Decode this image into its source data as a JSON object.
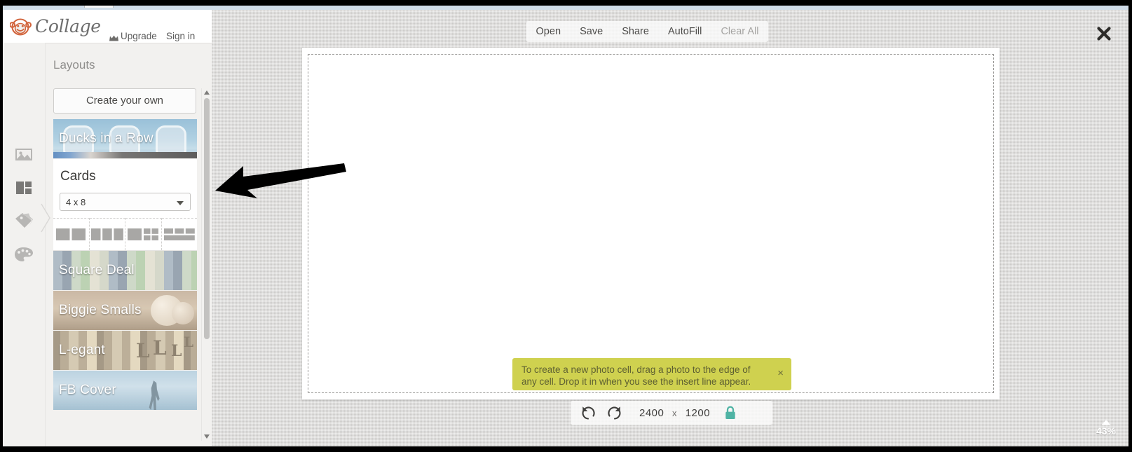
{
  "app": {
    "brand": "Collage",
    "logo_icon": "monkey-face-icon"
  },
  "topbar": {
    "upgrade_label": "Upgrade",
    "upgrade_icon": "crown-icon",
    "signin_label": "Sign in"
  },
  "panel": {
    "title": "Layouts",
    "create_own_label": "Create your own"
  },
  "rail": {
    "items": [
      {
        "name": "photos",
        "icon": "image-icon",
        "active": false
      },
      {
        "name": "layouts",
        "icon": "layouts-grid-icon",
        "active": true
      },
      {
        "name": "swatches",
        "icon": "tags-icon",
        "active": false
      },
      {
        "name": "effects",
        "icon": "palette-icon",
        "active": false
      }
    ],
    "collapse_icon": "chevron-right-icon"
  },
  "layouts": {
    "items": [
      {
        "label": "Ducks in a Row",
        "selected": true
      },
      {
        "label": "Cards",
        "expanded": true
      },
      {
        "label": "Square Deal",
        "selected": false
      },
      {
        "label": "Biggie Smalls",
        "selected": false
      },
      {
        "label": "L-egant",
        "selected": false
      },
      {
        "label": "FB Cover",
        "selected": false
      }
    ],
    "cards": {
      "title": "Cards",
      "size_value": "4 x 8",
      "size_caret_icon": "chevron-down-icon",
      "pattern_count": 4,
      "patterns": [
        "two-column",
        "three-column",
        "one-plus-four",
        "three-top-one-bottom"
      ]
    }
  },
  "scrollbar": {
    "up_icon": "caret-up-icon",
    "down_icon": "caret-down-icon"
  },
  "toolbar": {
    "items": [
      {
        "label": "Open",
        "disabled": false
      },
      {
        "label": "Save",
        "disabled": false
      },
      {
        "label": "Share",
        "disabled": false
      },
      {
        "label": "AutoFill",
        "disabled": false
      },
      {
        "label": "Clear All",
        "disabled": true
      }
    ]
  },
  "workspace": {
    "close_icon": "close-x-icon"
  },
  "toast": {
    "message": "To create a new photo cell, drag a photo to the edge of any cell. Drop it in when you see the insert line appear.",
    "close_label": "×",
    "background_color": "#cfd14f",
    "text_color": "#5e6032"
  },
  "bottombar": {
    "undo_icon": "undo-icon",
    "redo_icon": "redo-icon",
    "width": "2400",
    "separator": "x",
    "height": "1200",
    "lock_icon": "lock-closed-icon",
    "lock_color": "#4fb3a4"
  },
  "zoom": {
    "caret_icon": "caret-up-icon",
    "level": "43%"
  },
  "annotation": {
    "arrow_icon": "left-arrow-annotation",
    "color": "#000000"
  }
}
